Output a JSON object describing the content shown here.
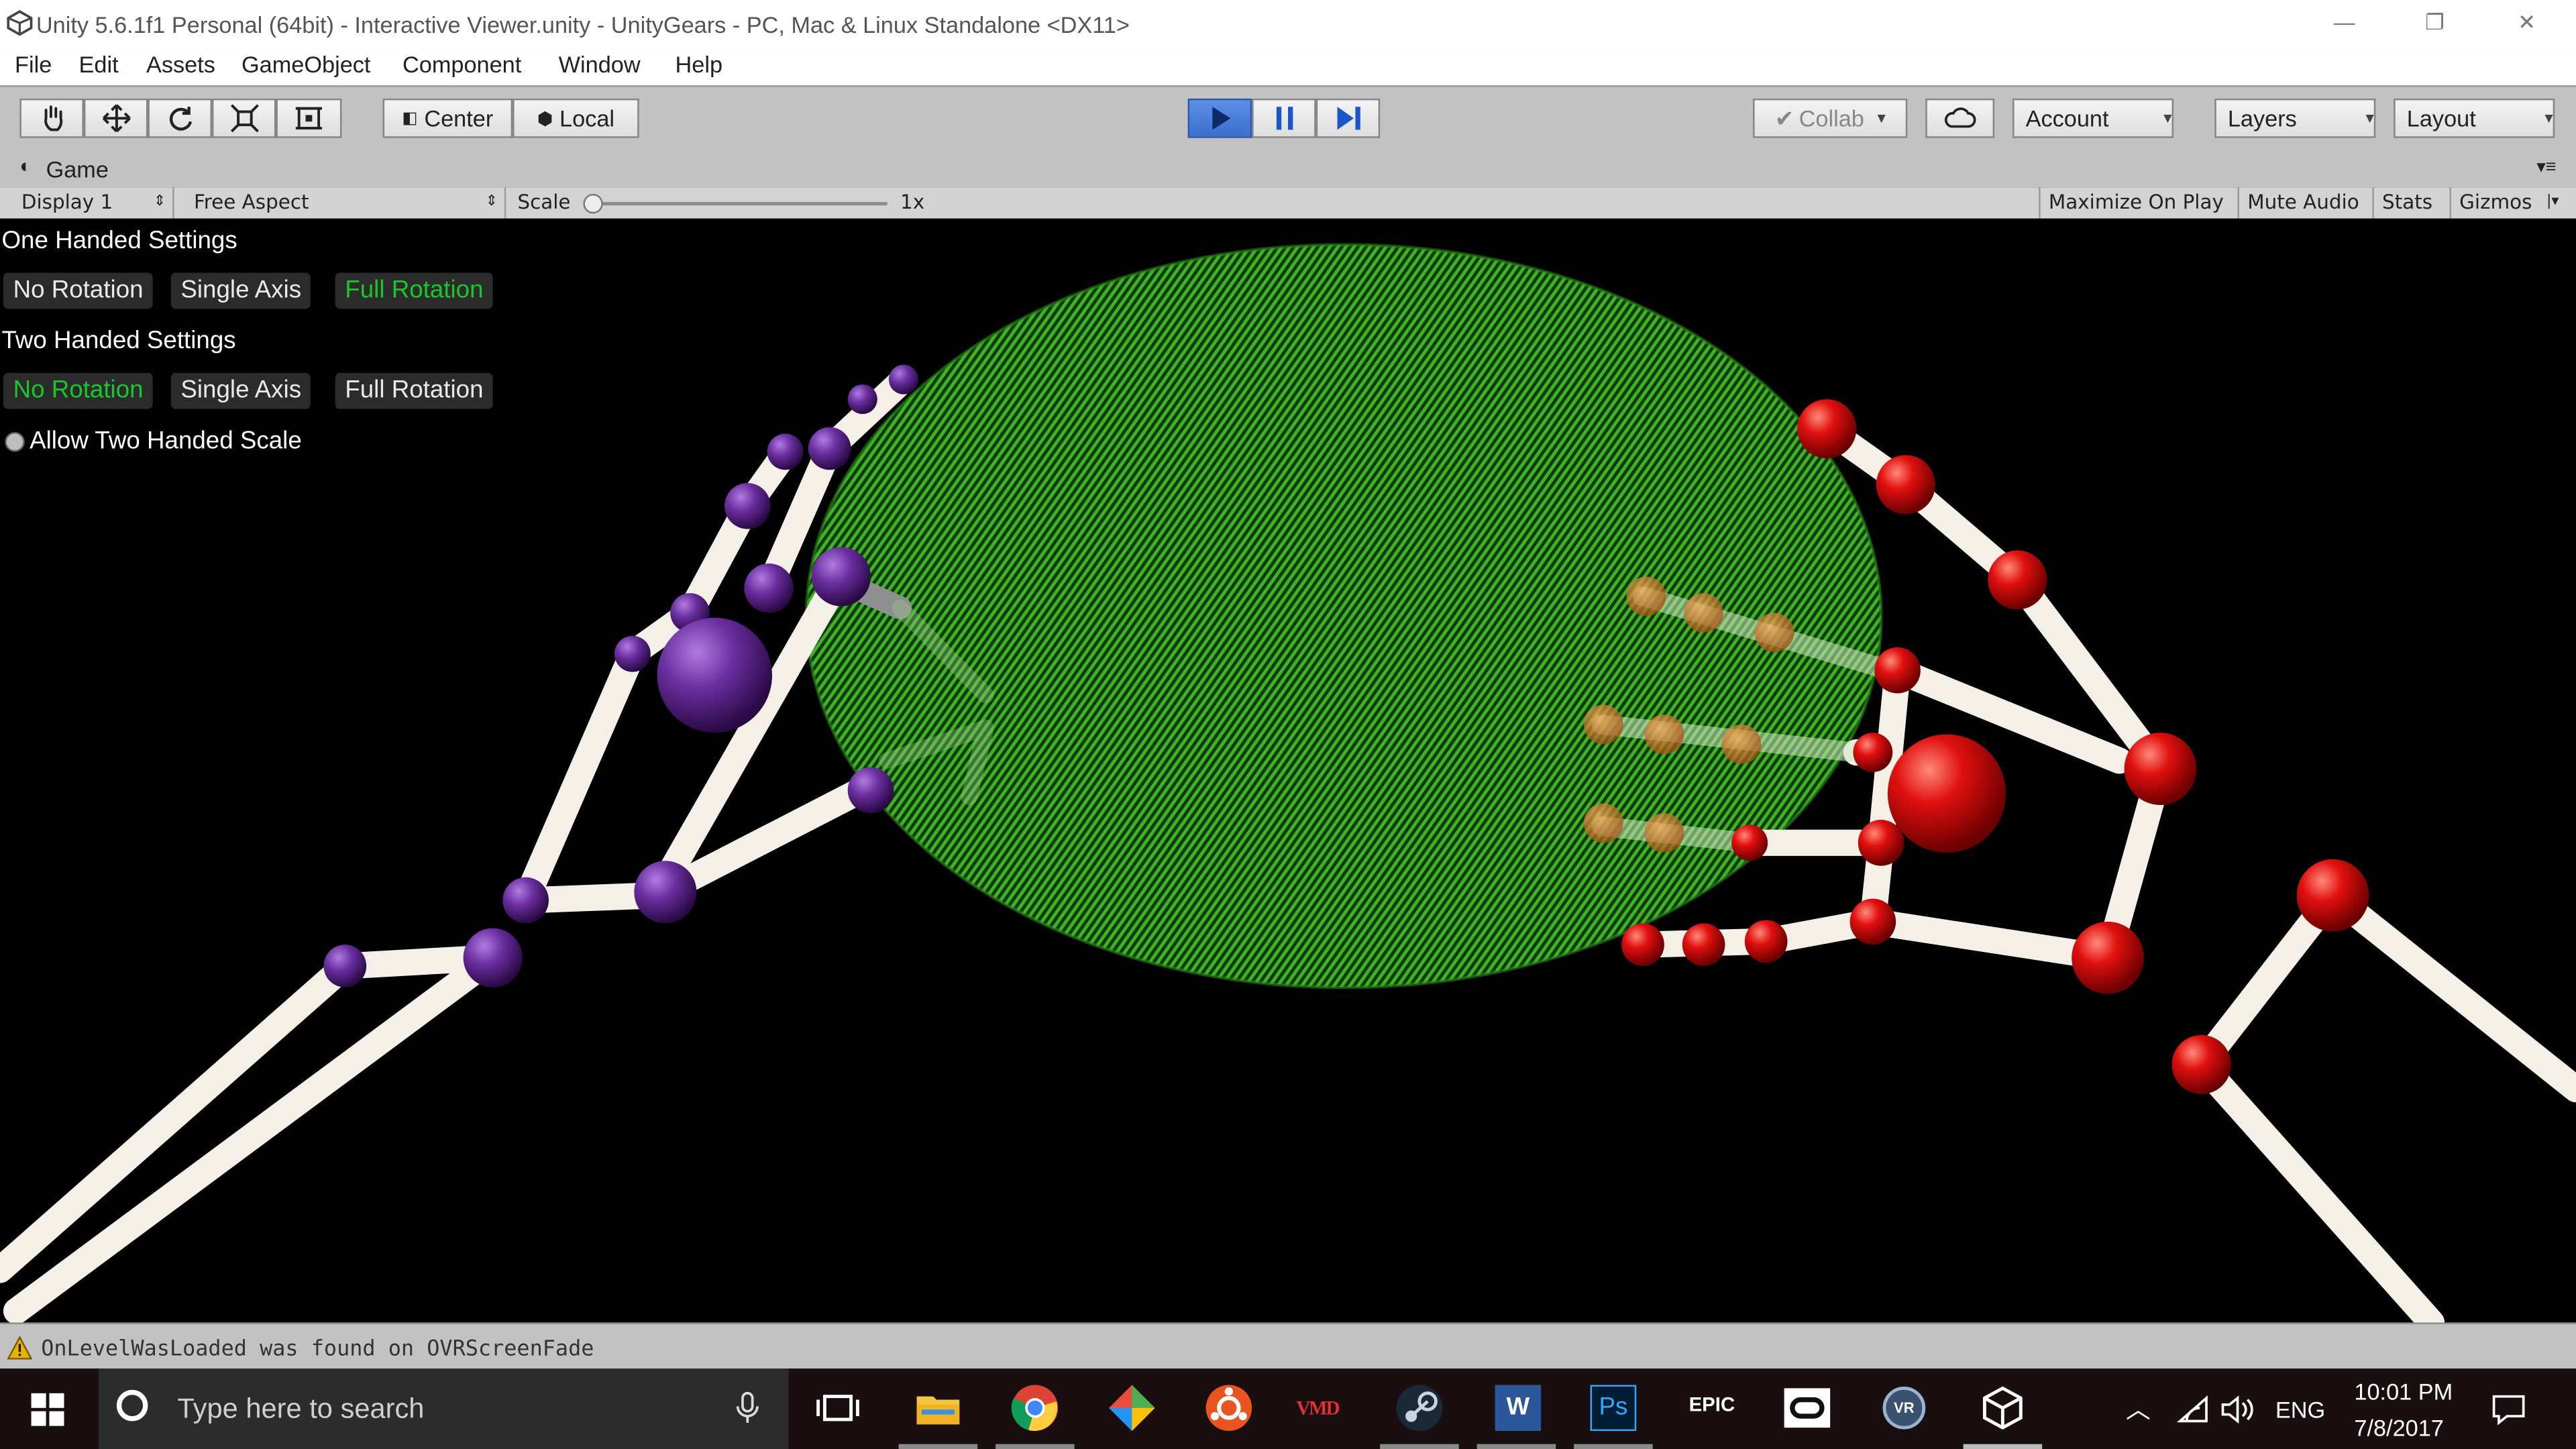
{
  "window": {
    "title": "Unity 5.6.1f1 Personal (64bit) - Interactive Viewer.unity - UnityGears - PC, Mac & Linux Standalone <DX11>",
    "minimize_glyph": "—",
    "restore_glyph": "❐",
    "close_glyph": "✕"
  },
  "menu": [
    "File",
    "Edit",
    "Assets",
    "GameObject",
    "Component",
    "Window",
    "Help"
  ],
  "toolbar": {
    "pivot_label": "Center",
    "space_label": "Local",
    "collab_label": "Collab",
    "account_label": "Account",
    "layers_label": "Layers",
    "layout_label": "Layout"
  },
  "game_view": {
    "tab_label": "Game",
    "display_label": "Display 1",
    "aspect_label": "Free Aspect",
    "scale_label": "Scale",
    "scale_value": "1x",
    "maximize_label": "Maximize On Play",
    "mute_label": "Mute Audio",
    "stats_label": "Stats",
    "gizmos_label": "Gizmos"
  },
  "overlay": {
    "one_handed_title": "One Handed Settings",
    "one_handed_options": [
      "No Rotation",
      "Single Axis",
      "Full Rotation"
    ],
    "one_handed_selected": "Full Rotation",
    "two_handed_title": "Two Handed Settings",
    "two_handed_options": [
      "No Rotation",
      "Single Axis",
      "Full Rotation"
    ],
    "two_handed_selected": "No Rotation",
    "scale_toggle_label": "Allow Two Handed Scale"
  },
  "status": {
    "message": "OnLevelWasLoaded was found on OVRScreenFade"
  },
  "taskbar": {
    "search_placeholder": "Type here to search",
    "language": "ENG",
    "time": "10:01 PM",
    "date": "7/8/2017",
    "vmd_label": "VMD",
    "epic_label": "EPIC",
    "vr_label": "VR",
    "ps_label": "Ps",
    "word_label": "W"
  },
  "colors": {
    "toolbar_bg": "#c2c2c2",
    "play_active": "#3b6ed0",
    "selected_option": "#19c72a",
    "sphere_green": "#3aa51f",
    "left_hand": "#6a2fa0",
    "right_hand": "#e0100f"
  }
}
